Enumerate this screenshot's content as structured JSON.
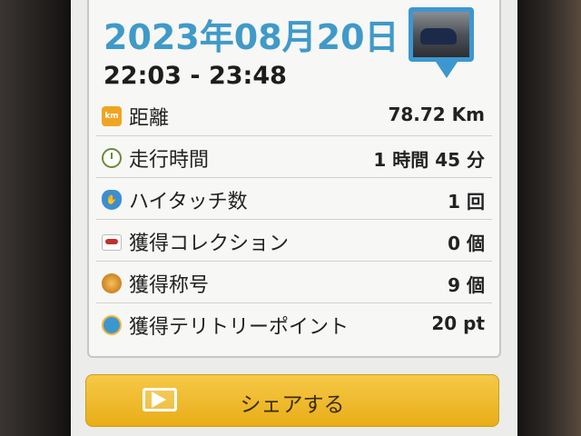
{
  "summary": {
    "date": "2023年08月20日",
    "time_range": "22:03 - 23:48"
  },
  "stats": [
    {
      "icon": "km-badge-icon",
      "icon_text": "km",
      "label": "距離",
      "value": "78.72 Km"
    },
    {
      "icon": "clock-icon",
      "label": "走行時間",
      "value": "1 時間 45 分"
    },
    {
      "icon": "high-five-hand-icon",
      "label": "ハイタッチ数",
      "value": "1 回"
    },
    {
      "icon": "car-collection-icon",
      "label": "獲得コレクション",
      "value": "0 個"
    },
    {
      "icon": "medal-icon",
      "label": "獲得称号",
      "value": "9 個"
    },
    {
      "icon": "territory-point-icon",
      "label": "獲得テリトリーポイント",
      "value": "20 pt"
    }
  ],
  "share": {
    "label": "シェアする",
    "icon": "share-arrow-icon"
  },
  "colors": {
    "date_blue": "#3f9ac8",
    "share_yellow": "#f2bd2e"
  }
}
